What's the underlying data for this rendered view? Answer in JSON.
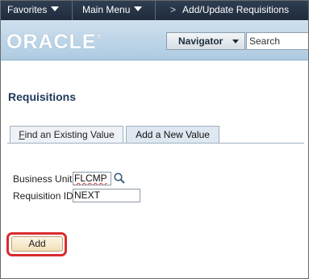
{
  "topnav": {
    "favorites": "Favorites",
    "main_menu": "Main Menu",
    "breadcrumb_separator": ">",
    "breadcrumb": "Add/Update Requisitions"
  },
  "header": {
    "logo": "ORACLE",
    "logo_mark": "®",
    "navigator": "Navigator",
    "search_value": "Search"
  },
  "page": {
    "title": "Requisitions",
    "tabs": [
      {
        "label_underlined": "F",
        "label_rest": "ind an Existing Value",
        "active": false
      },
      {
        "label": "Add a New Value",
        "active": true
      }
    ]
  },
  "form": {
    "business_unit_label": "Business Unit",
    "business_unit_value": "FLCMP",
    "requisition_id_label": "Requisition ID",
    "requisition_id_value": "NEXT"
  },
  "actions": {
    "add_label": "Add"
  },
  "colors": {
    "nav_bar": "#1f2b3b",
    "header_blue": "#aecbe2",
    "highlight_red": "#d92c2c",
    "title_blue": "#1f3a5c"
  }
}
